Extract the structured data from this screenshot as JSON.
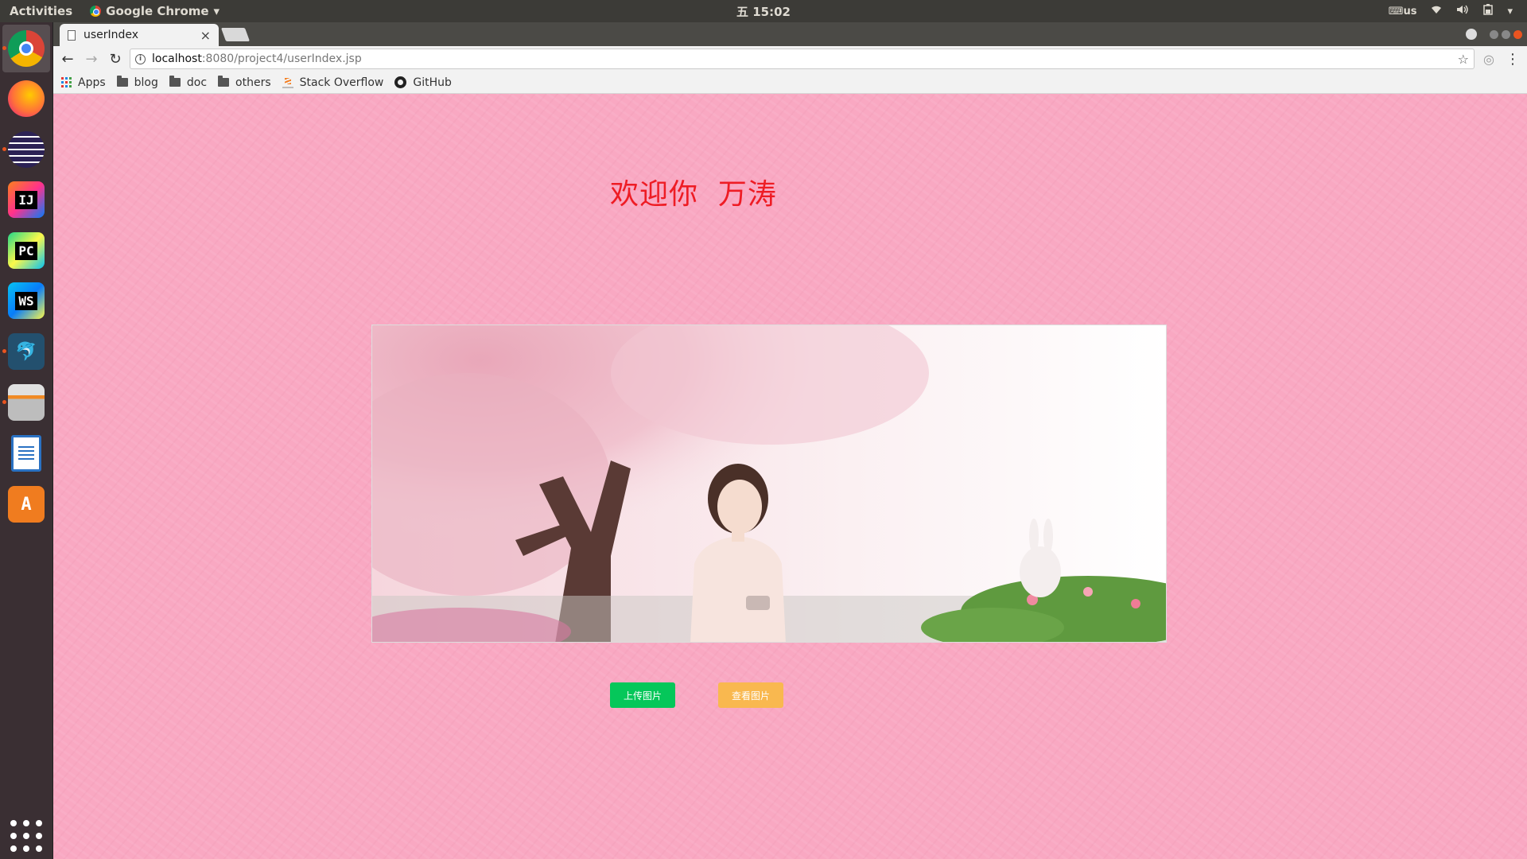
{
  "topbar": {
    "activities": "Activities",
    "app_name": "Google Chrome",
    "clock": "五 15:02",
    "keyboard": "us"
  },
  "launcher": {
    "apps": [
      "chrome-icon",
      "firefox-icon",
      "eclipse-icon",
      "intellij-icon",
      "pycharm-icon",
      "webstorm-icon",
      "mysql-workbench-icon",
      "file-manager-icon",
      "libreoffice-writer-icon",
      "software-center-icon",
      "show-applications-icon"
    ]
  },
  "browser": {
    "tab_title": "userIndex",
    "url_host": "localhost",
    "url_path": ":8080/project4/userIndex.jsp",
    "bookmarks": [
      "Apps",
      "blog",
      "doc",
      "others",
      "Stack Overflow",
      "GitHub"
    ]
  },
  "page": {
    "welcome": "欢迎你  万涛",
    "upload_button": "上传图片",
    "view_button": "查看图片",
    "colors": {
      "background": "#f9a8c2",
      "welcome_text": "#ee1c24",
      "upload_button": "#05c75a",
      "view_button": "#f9b84f"
    }
  }
}
